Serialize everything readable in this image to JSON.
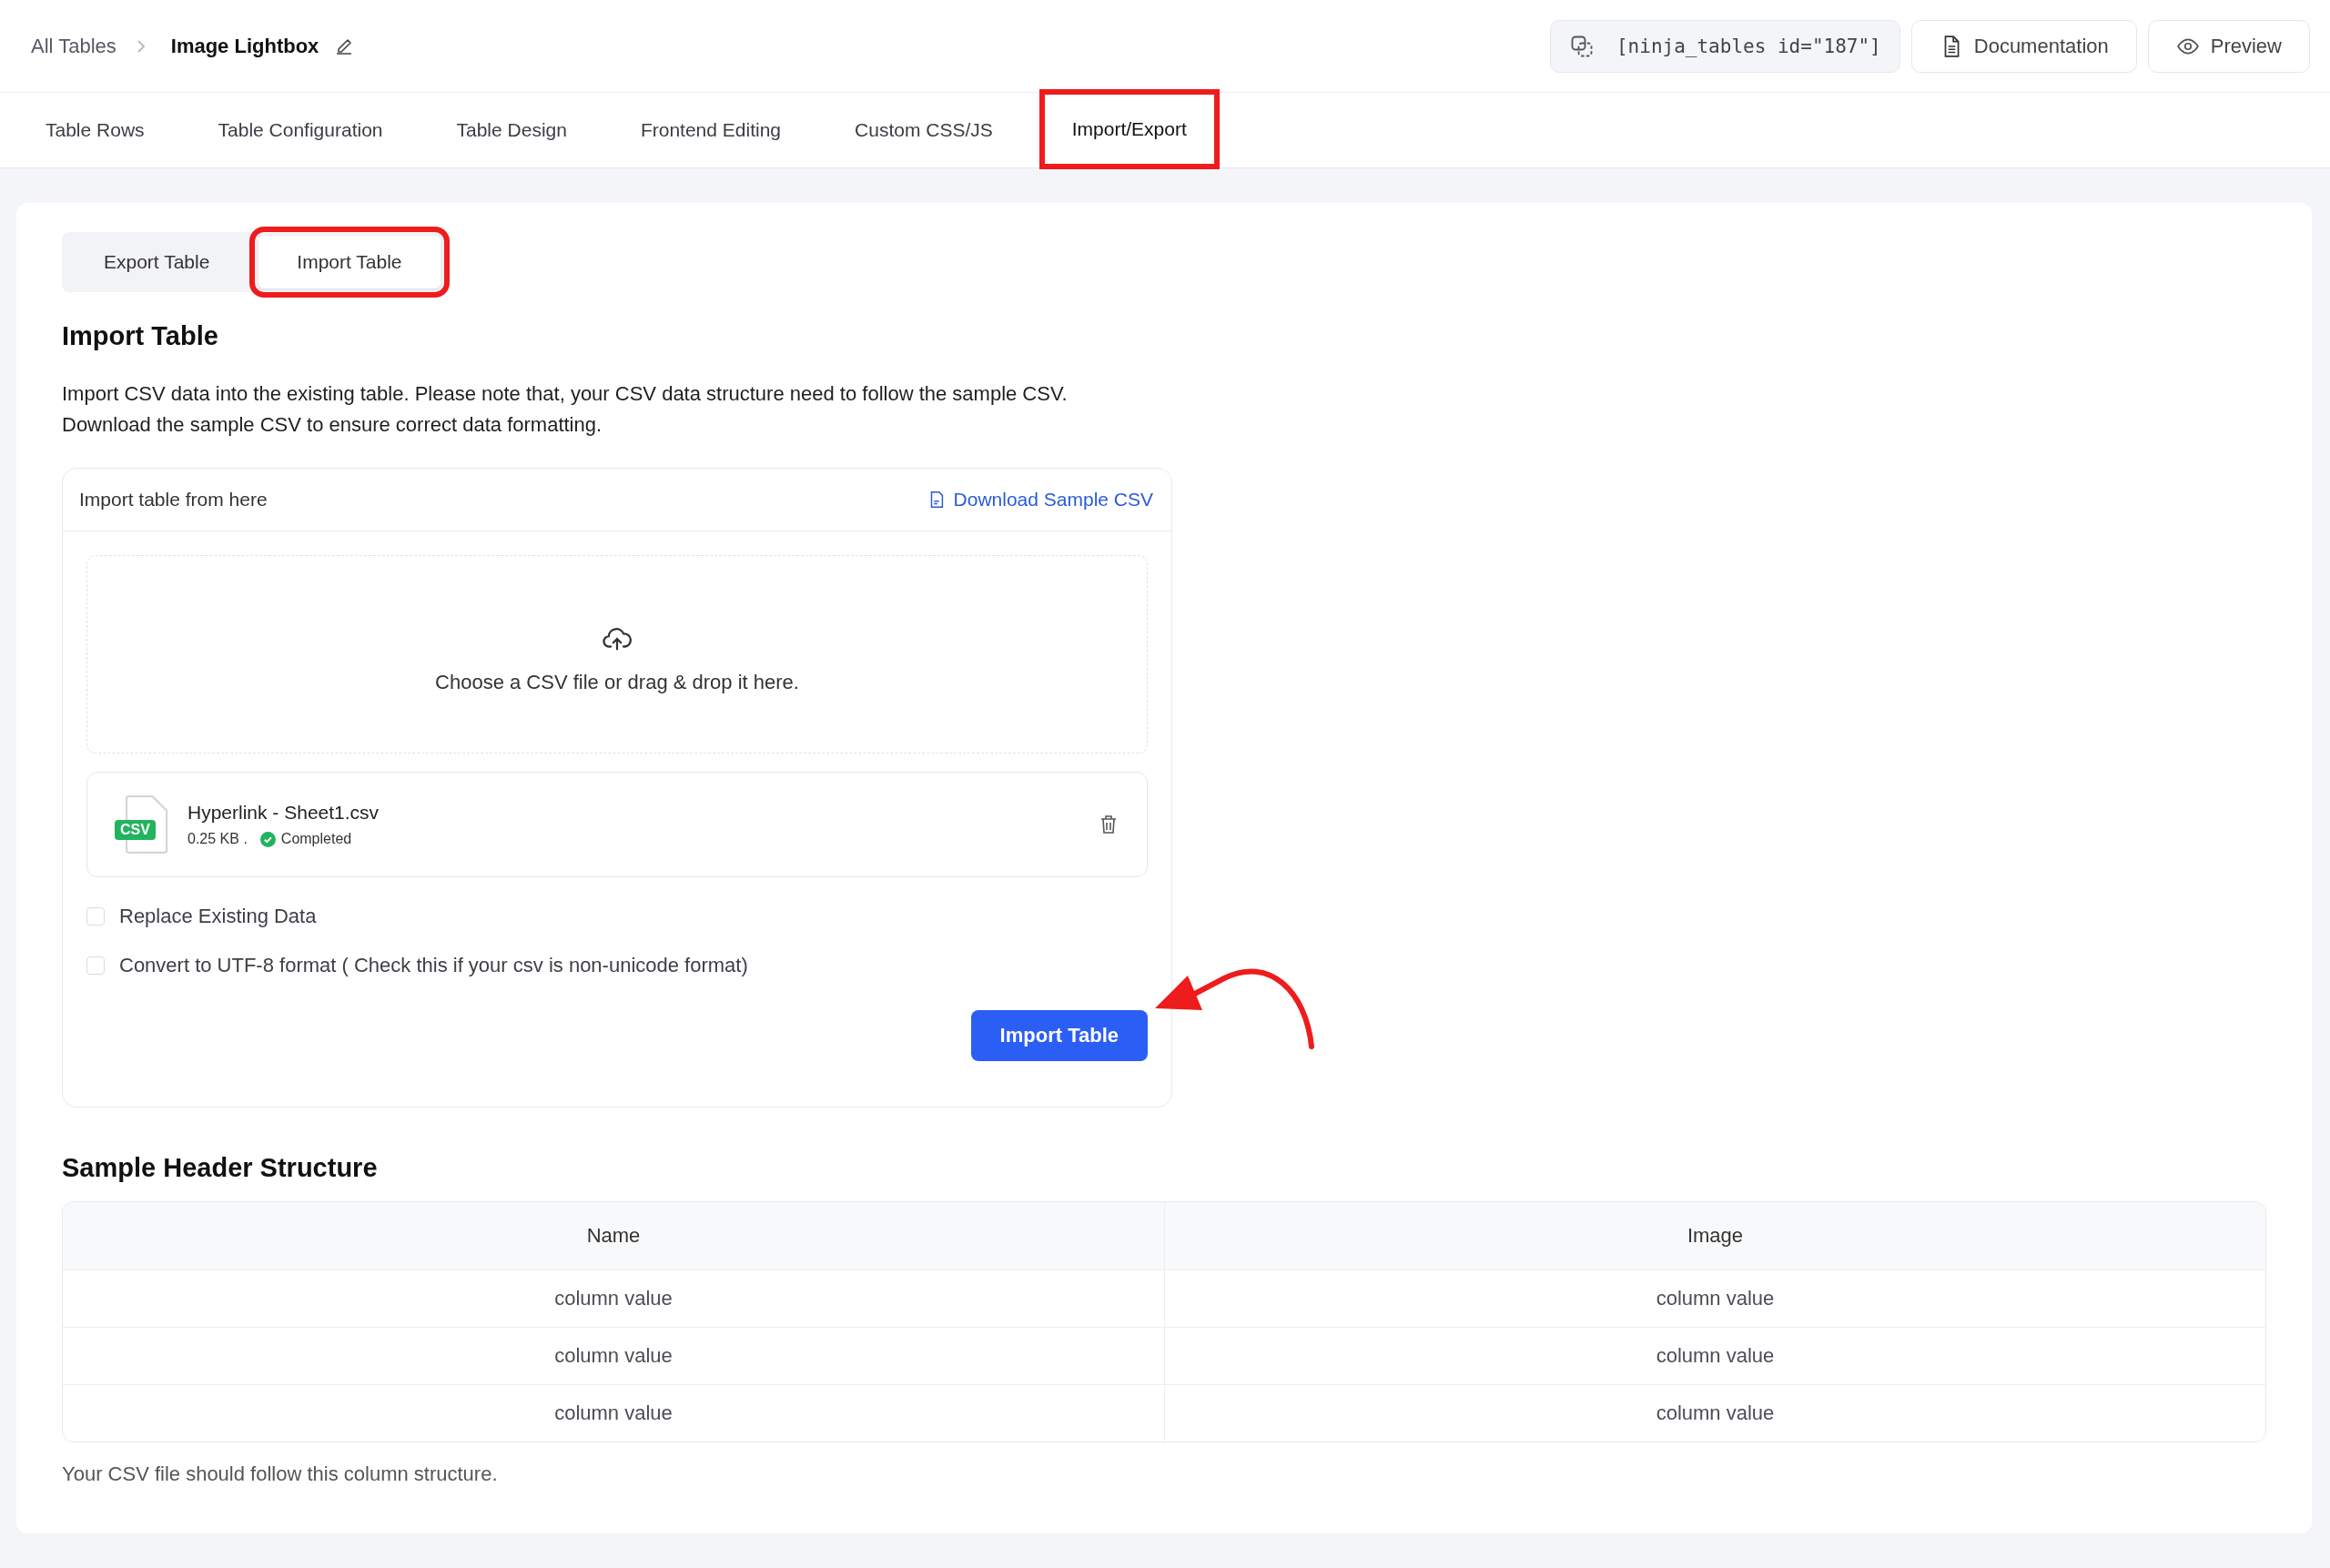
{
  "breadcrumb": {
    "parent": "All Tables",
    "current": "Image Lightbox"
  },
  "header_actions": {
    "shortcode": "[ninja_tables id=\"187\"]",
    "documentation": "Documentation",
    "preview": "Preview"
  },
  "tabs": [
    {
      "label": "Table Rows",
      "selected": false,
      "highlighted": false
    },
    {
      "label": "Table Configuration",
      "selected": false,
      "highlighted": false
    },
    {
      "label": "Table Design",
      "selected": false,
      "highlighted": false
    },
    {
      "label": "Frontend Editing",
      "selected": false,
      "highlighted": false
    },
    {
      "label": "Custom CSS/JS",
      "selected": false,
      "highlighted": false
    },
    {
      "label": "Import/Export",
      "selected": true,
      "highlighted": true
    }
  ],
  "sub_tabs": [
    {
      "label": "Export Table",
      "selected": false,
      "highlighted": false
    },
    {
      "label": "Import Table",
      "selected": true,
      "highlighted": true
    }
  ],
  "section_title": "Import Table",
  "description": [
    "Import CSV data into the existing table. Please note that, your CSV data structure need to follow the sample CSV.",
    "Download the sample CSV to ensure correct data formatting."
  ],
  "upload_card": {
    "title": "Import table from here",
    "download_link": "Download Sample CSV",
    "dropzone_text": "Choose a CSV file or drag & drop it here.",
    "file": {
      "badge": "CSV",
      "name": "Hyperlink - Sheet1.csv",
      "size": "0.25 KB .",
      "status": "Completed"
    },
    "options": [
      {
        "label": "Replace Existing Data",
        "checked": false
      },
      {
        "label": "Convert to UTF-8 format ( Check this if your csv is non-unicode format)",
        "checked": false
      }
    ],
    "submit": "Import Table"
  },
  "sample": {
    "title": "Sample Header Structure",
    "columns": [
      "Name",
      "Image"
    ],
    "rows": [
      [
        "column value",
        "column value"
      ],
      [
        "column value",
        "column value"
      ],
      [
        "column value",
        "column value"
      ]
    ],
    "note": "Your CSV file should follow this column structure."
  }
}
